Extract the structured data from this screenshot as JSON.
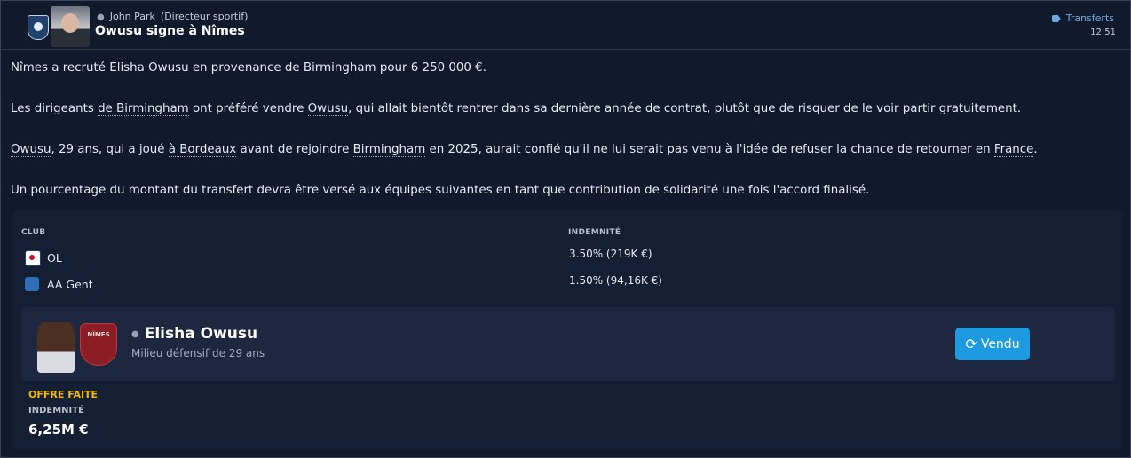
{
  "header": {
    "author_name": "John Park",
    "author_role": "(Directeur sportif)",
    "headline": "Owusu signe à Nîmes",
    "category": "Transferts",
    "time": "12:51"
  },
  "body": {
    "p1": [
      "Nîmes",
      " a recruté ",
      "Elisha Owusu",
      " en provenance ",
      "de Birmingham",
      " pour 6 250 000 €."
    ],
    "p2": [
      "Les dirigeants ",
      "de Birmingham",
      " ont préféré vendre ",
      "Owusu",
      ", qui allait bientôt rentrer dans sa dernière année de contrat, plutôt que de risquer de le voir partir gratuitement."
    ],
    "p3": [
      "Owusu",
      ", 29 ans, qui a joué ",
      "à Bordeaux",
      " avant de rejoindre ",
      "Birmingham",
      " en 2025, aurait confié qu'il ne lui serait pas venu à l'idée de refuser la chance de retourner en ",
      "France",
      "."
    ],
    "p4": "Un pourcentage du montant du transfert devra être versé aux équipes suivantes en tant que contribution de solidarité une fois l'accord finalisé."
  },
  "solidarity": {
    "col_club": "CLUB",
    "col_fee": "INDEMNITÉ",
    "rows": [
      {
        "club": "OL",
        "fee": "3.50% (219K €)",
        "logo": "ol-logo"
      },
      {
        "club": "AA Gent",
        "fee": "1.50% (94,16K €)",
        "logo": "gent-logo"
      }
    ]
  },
  "player": {
    "name": "Elisha Owusu",
    "description": "Milieu défensif de 29 ans",
    "club_badge_text": "NÎMES",
    "button_label": "Vendu"
  },
  "offer": {
    "status": "OFFRE FAITE",
    "label": "INDEMNITÉ",
    "value": "6,25M €"
  },
  "colors": {
    "background": "#111a2d",
    "accent_blue": "#1e9be0",
    "status_yellow": "#f5b800",
    "link_blue": "#6fa8dc"
  }
}
